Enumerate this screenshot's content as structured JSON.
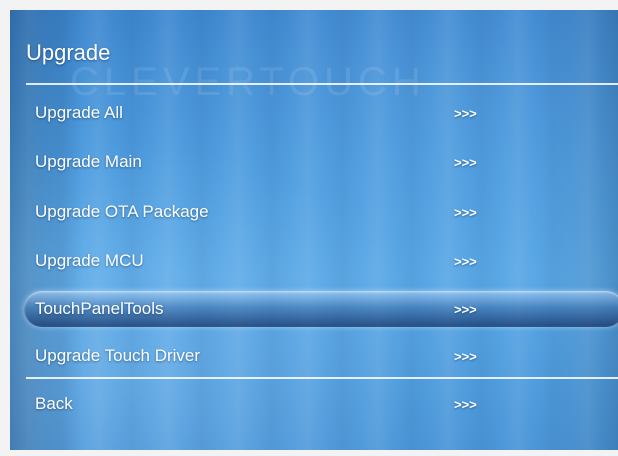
{
  "menu": {
    "title": "Upgrade",
    "watermark": "CLEVERTOUCH",
    "selected_index": 4,
    "items": [
      {
        "label": "Upgrade All",
        "arrow": ">>>"
      },
      {
        "label": "Upgrade Main",
        "arrow": ">>>"
      },
      {
        "label": "Upgrade OTA Package",
        "arrow": ">>>"
      },
      {
        "label": "Upgrade MCU",
        "arrow": ">>>"
      },
      {
        "label": "TouchPanelTools",
        "arrow": ">>>"
      },
      {
        "label": "Upgrade Touch Driver",
        "arrow": ">>>"
      },
      {
        "label": "Back",
        "arrow": ">>>"
      }
    ]
  },
  "colors": {
    "background": "#4f9ddf",
    "text": "#ffffff",
    "divider": "#ffffff"
  }
}
